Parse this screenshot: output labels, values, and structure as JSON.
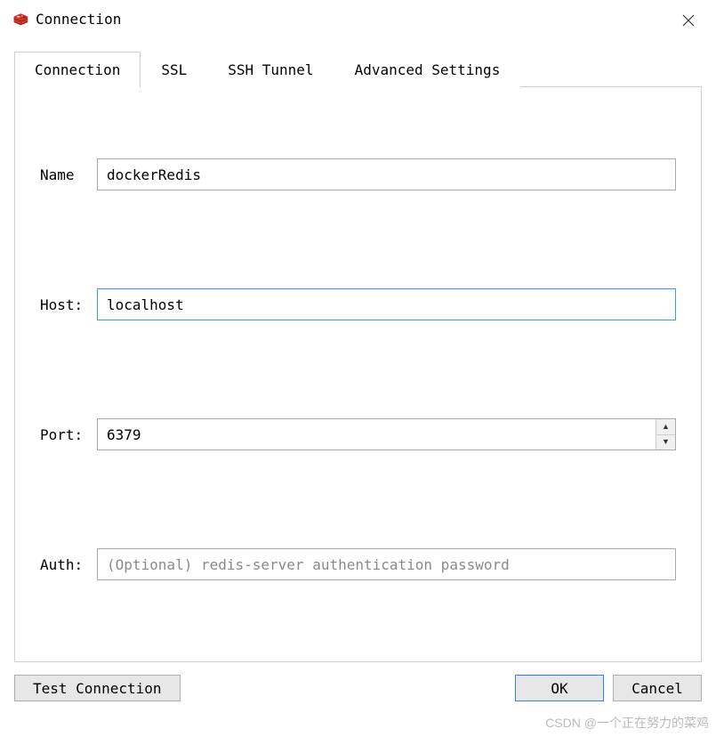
{
  "window": {
    "title": "Connection"
  },
  "tabs": {
    "connection": "Connection",
    "ssl": "SSL",
    "ssh_tunnel": "SSH Tunnel",
    "advanced": "Advanced Settings"
  },
  "form": {
    "name_label": "Name",
    "name_value": "dockerRedis",
    "host_label": "Host:",
    "host_value": "localhost",
    "port_label": "Port:",
    "port_value": "6379",
    "auth_label": "Auth:",
    "auth_value": "",
    "auth_placeholder": "(Optional) redis-server authentication password"
  },
  "buttons": {
    "test": "Test Connection",
    "ok": "OK",
    "cancel": "Cancel"
  },
  "watermark": "CSDN @一个正在努力的菜鸡"
}
